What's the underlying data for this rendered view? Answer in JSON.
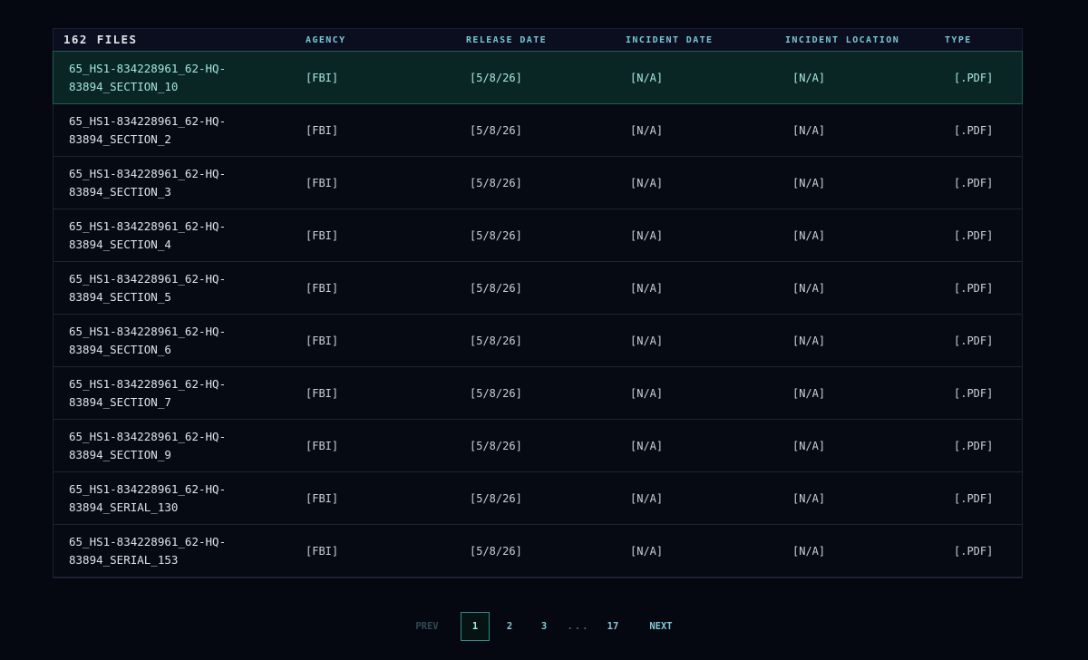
{
  "table": {
    "file_count": "162",
    "columns": {
      "files": "FILES",
      "agency": "AGENCY",
      "release_date": "RELEASE DATE",
      "incident_date": "INCIDENT DATE",
      "incident_location": "INCIDENT LOCATION",
      "type": "TYPE"
    },
    "rows": [
      {
        "name_line1": "65_HS1-834228961_62-HQ-",
        "name_line2": "83894_SECTION_10",
        "agency": "[FBI]",
        "release_date": "[5/8/26]",
        "incident_date": "[N/A]",
        "incident_location": "[N/A]",
        "type": "[.PDF]"
      },
      {
        "name_line1": "65_HS1-834228961_62-HQ-",
        "name_line2": "83894_SECTION_2",
        "agency": "[FBI]",
        "release_date": "[5/8/26]",
        "incident_date": "[N/A]",
        "incident_location": "[N/A]",
        "type": "[.PDF]"
      },
      {
        "name_line1": "65_HS1-834228961_62-HQ-",
        "name_line2": "83894_SECTION_3",
        "agency": "[FBI]",
        "release_date": "[5/8/26]",
        "incident_date": "[N/A]",
        "incident_location": "[N/A]",
        "type": "[.PDF]"
      },
      {
        "name_line1": "65_HS1-834228961_62-HQ-",
        "name_line2": "83894_SECTION_4",
        "agency": "[FBI]",
        "release_date": "[5/8/26]",
        "incident_date": "[N/A]",
        "incident_location": "[N/A]",
        "type": "[.PDF]"
      },
      {
        "name_line1": "65_HS1-834228961_62-HQ-",
        "name_line2": "83894_SECTION_5",
        "agency": "[FBI]",
        "release_date": "[5/8/26]",
        "incident_date": "[N/A]",
        "incident_location": "[N/A]",
        "type": "[.PDF]"
      },
      {
        "name_line1": "65_HS1-834228961_62-HQ-",
        "name_line2": "83894_SECTION_6",
        "agency": "[FBI]",
        "release_date": "[5/8/26]",
        "incident_date": "[N/A]",
        "incident_location": "[N/A]",
        "type": "[.PDF]"
      },
      {
        "name_line1": "65_HS1-834228961_62-HQ-",
        "name_line2": "83894_SECTION_7",
        "agency": "[FBI]",
        "release_date": "[5/8/26]",
        "incident_date": "[N/A]",
        "incident_location": "[N/A]",
        "type": "[.PDF]"
      },
      {
        "name_line1": "65_HS1-834228961_62-HQ-",
        "name_line2": "83894_SECTION_9",
        "agency": "[FBI]",
        "release_date": "[5/8/26]",
        "incident_date": "[N/A]",
        "incident_location": "[N/A]",
        "type": "[.PDF]"
      },
      {
        "name_line1": "65_HS1-834228961_62-HQ-",
        "name_line2": "83894_SERIAL_130",
        "agency": "[FBI]",
        "release_date": "[5/8/26]",
        "incident_date": "[N/A]",
        "incident_location": "[N/A]",
        "type": "[.PDF]"
      },
      {
        "name_line1": "65_HS1-834228961_62-HQ-",
        "name_line2": "83894_SERIAL_153",
        "agency": "[FBI]",
        "release_date": "[5/8/26]",
        "incident_date": "[N/A]",
        "incident_location": "[N/A]",
        "type": "[.PDF]"
      }
    ]
  },
  "pagination": {
    "prev": "PREV",
    "pages": [
      "1",
      "2",
      "3"
    ],
    "ellipsis": "...",
    "last": "17",
    "next": "NEXT",
    "current": "1"
  },
  "colors": {
    "background": "#050810",
    "accent": "#79c6d4",
    "selected_row": "#0a2624"
  }
}
